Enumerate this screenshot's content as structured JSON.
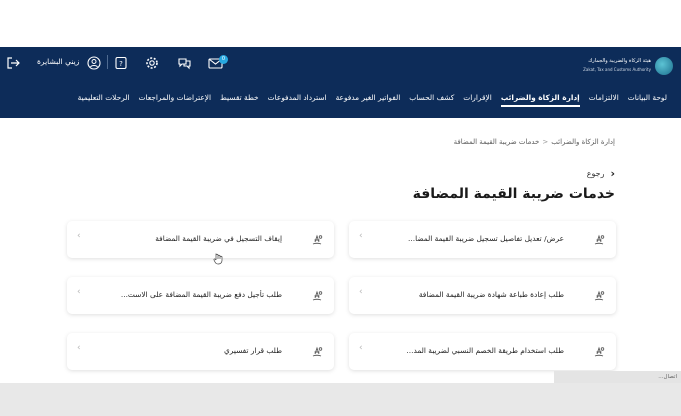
{
  "header": {
    "logo_ar": "هيئة الزكاة والضريبة والجمارك",
    "logo_en": "Zakat, Tax and Customs Authority",
    "user_name": "زيني البشايرة",
    "notification_count": "0"
  },
  "nav": {
    "items": [
      "لوحة البيانات",
      "الالتزامات",
      "إدارة الزكاة والضرائب",
      "الإقرارات",
      "كشف الحساب",
      "الفواتير الغير مدفوعة",
      "استرداد المدفوعات",
      "خطة تقسيط",
      "الإعتراضات والمراجعات",
      "الرحلات التعليمية"
    ],
    "active_index": 2
  },
  "breadcrumb": {
    "parent": "إدارة الزكاة والضرائب",
    "separator": "<",
    "current": "خدمات ضريبة القيمة المضافة"
  },
  "back_label": "رجوع",
  "page_title": "خدمات ضريبة القيمة المضافة",
  "cards": [
    "عرض/ تعديل تفاصيل تسجيل ضريبة القيمة المضا...",
    "إيقاف التسجيل في ضريبة القيمة المضافة",
    "طلب إعادة طباعة شهادة ضريبة القيمة المضافة",
    "طلب تأجيل دفع ضريبة القيمة المضافة على الاست...",
    "طلب استخدام طريقة الخصم النسبي لضريبة المد...",
    "طلب قرار تفسيري"
  ],
  "status_bar": {
    "url_text": "اتصال..."
  },
  "colors": {
    "header_bg": "#0d2c59",
    "accent": "#27a8e0",
    "card_text": "#222222"
  }
}
